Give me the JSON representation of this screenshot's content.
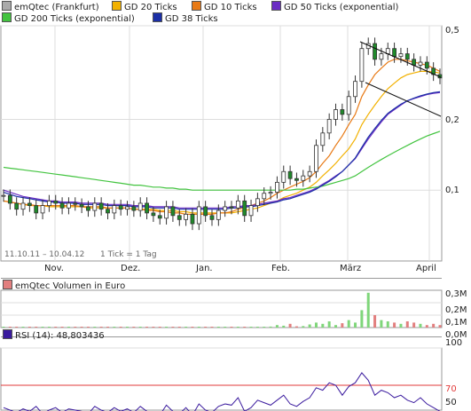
{
  "legend": [
    {
      "label": "emQtec (Frankfurt)",
      "color": "#aaaaaa"
    },
    {
      "label": "GD 20 Ticks",
      "color": "#f2b100"
    },
    {
      "label": "GD 10 Ticks",
      "color": "#e87a16"
    },
    {
      "label": "GD 50 Ticks (exponential)",
      "color": "#6a2cc4"
    },
    {
      "label": "GD 200 Ticks (exponential)",
      "color": "#43c440"
    },
    {
      "label": "GD 38 Ticks",
      "color": "#1b2fa6"
    }
  ],
  "price_panel": {
    "date_range": "11.10.11 – 10.04.12",
    "tick_info": "1 Tick = 1 Tag",
    "y_ticks": [
      "0,5",
      "0,2",
      "0,1"
    ],
    "x_ticks": [
      "Nov.",
      "Dez.",
      "Jan.",
      "Feb.",
      "März",
      "April"
    ]
  },
  "volume_panel": {
    "title": "emQtec Volumen in Euro",
    "y_ticks": [
      "0,3M",
      "0,2M",
      "0,1M",
      "0,0M"
    ],
    "color_up": "#7fd67a",
    "color_down": "#e27f7f"
  },
  "rsi_panel": {
    "title": "RSI (14): 48,803436",
    "y_ticks": [
      "100",
      "70",
      "50"
    ],
    "line_color": "#3a1a9e",
    "ref_color": "#e23a3a"
  },
  "chart_data": {
    "type": "line",
    "price": {
      "scale": "log",
      "ylim": [
        0.05,
        0.5
      ],
      "months": [
        "Nov.",
        "Dez.",
        "Jan.",
        "Feb.",
        "März",
        "April"
      ],
      "series": [
        {
          "name": "emQtec (Frankfurt)",
          "values": [
            0.095,
            0.088,
            0.083,
            0.088,
            0.086,
            0.08,
            0.086,
            0.09,
            0.088,
            0.084,
            0.088,
            0.087,
            0.085,
            0.082,
            0.088,
            0.083,
            0.08,
            0.086,
            0.083,
            0.085,
            0.082,
            0.088,
            0.08,
            0.078,
            0.076,
            0.085,
            0.078,
            0.075,
            0.079,
            0.072,
            0.085,
            0.078,
            0.075,
            0.082,
            0.085,
            0.084,
            0.09,
            0.078,
            0.086,
            0.092,
            0.097,
            0.098,
            0.108,
            0.12,
            0.112,
            0.11,
            0.115,
            0.12,
            0.155,
            0.175,
            0.2,
            0.22,
            0.21,
            0.25,
            0.29,
            0.4,
            0.42,
            0.36,
            0.38,
            0.4,
            0.37,
            0.38,
            0.36,
            0.34,
            0.35,
            0.33,
            0.31,
            0.3
          ]
        },
        {
          "name": "GD 20 Ticks",
          "values": [
            0.09,
            0.089,
            0.088,
            0.087,
            0.086,
            0.086,
            0.086,
            0.085,
            0.085,
            0.085,
            0.085,
            0.085,
            0.085,
            0.084,
            0.084,
            0.084,
            0.084,
            0.084,
            0.084,
            0.084,
            0.083,
            0.083,
            0.083,
            0.083,
            0.082,
            0.082,
            0.082,
            0.081,
            0.081,
            0.08,
            0.08,
            0.08,
            0.08,
            0.08,
            0.08,
            0.08,
            0.081,
            0.082,
            0.083,
            0.084,
            0.086,
            0.088,
            0.09,
            0.093,
            0.095,
            0.097,
            0.1,
            0.103,
            0.108,
            0.115,
            0.122,
            0.13,
            0.14,
            0.15,
            0.165,
            0.19,
            0.21,
            0.23,
            0.25,
            0.27,
            0.285,
            0.3,
            0.31,
            0.315,
            0.32,
            0.32,
            0.318,
            0.315
          ]
        },
        {
          "name": "GD 10 Ticks",
          "values": [
            0.09,
            0.089,
            0.088,
            0.087,
            0.087,
            0.086,
            0.086,
            0.086,
            0.086,
            0.086,
            0.086,
            0.086,
            0.085,
            0.085,
            0.085,
            0.085,
            0.084,
            0.084,
            0.084,
            0.084,
            0.083,
            0.083,
            0.082,
            0.082,
            0.081,
            0.081,
            0.08,
            0.08,
            0.079,
            0.079,
            0.079,
            0.079,
            0.079,
            0.08,
            0.08,
            0.081,
            0.083,
            0.084,
            0.086,
            0.088,
            0.09,
            0.093,
            0.097,
            0.1,
            0.103,
            0.106,
            0.109,
            0.113,
            0.12,
            0.13,
            0.14,
            0.155,
            0.17,
            0.19,
            0.21,
            0.25,
            0.28,
            0.31,
            0.33,
            0.35,
            0.36,
            0.36,
            0.355,
            0.35,
            0.345,
            0.34,
            0.33,
            0.32
          ]
        },
        {
          "name": "GD 50 Ticks (exponential)",
          "values": [
            0.1,
            0.098,
            0.096,
            0.094,
            0.093,
            0.092,
            0.091,
            0.09,
            0.09,
            0.089,
            0.089,
            0.089,
            0.088,
            0.088,
            0.088,
            0.088,
            0.087,
            0.087,
            0.087,
            0.087,
            0.086,
            0.086,
            0.086,
            0.085,
            0.085,
            0.085,
            0.085,
            0.084,
            0.084,
            0.084,
            0.084,
            0.084,
            0.084,
            0.084,
            0.084,
            0.085,
            0.085,
            0.086,
            0.086,
            0.087,
            0.088,
            0.089,
            0.09,
            0.092,
            0.093,
            0.095,
            0.097,
            0.099,
            0.102,
            0.106,
            0.11,
            0.115,
            0.12,
            0.128,
            0.136,
            0.15,
            0.165,
            0.18,
            0.195,
            0.21,
            0.22,
            0.23,
            0.24,
            0.245,
            0.25,
            0.255,
            0.258,
            0.26
          ]
        },
        {
          "name": "GD 200 Ticks (exponential)",
          "values": [
            0.125,
            0.124,
            0.123,
            0.122,
            0.121,
            0.12,
            0.119,
            0.118,
            0.117,
            0.116,
            0.115,
            0.114,
            0.113,
            0.112,
            0.111,
            0.11,
            0.109,
            0.108,
            0.107,
            0.106,
            0.105,
            0.105,
            0.104,
            0.103,
            0.103,
            0.102,
            0.102,
            0.101,
            0.101,
            0.1,
            0.1,
            0.1,
            0.1,
            0.1,
            0.1,
            0.1,
            0.1,
            0.1,
            0.1,
            0.1,
            0.1,
            0.1,
            0.1,
            0.1,
            0.1,
            0.101,
            0.101,
            0.102,
            0.103,
            0.104,
            0.106,
            0.108,
            0.11,
            0.112,
            0.115,
            0.12,
            0.125,
            0.13,
            0.135,
            0.14,
            0.145,
            0.15,
            0.155,
            0.16,
            0.165,
            0.17,
            0.174,
            0.178
          ]
        },
        {
          "name": "GD 38 Ticks",
          "values": [
            0.098,
            0.096,
            0.094,
            0.093,
            0.092,
            0.091,
            0.09,
            0.089,
            0.089,
            0.088,
            0.088,
            0.088,
            0.087,
            0.087,
            0.087,
            0.087,
            0.086,
            0.086,
            0.086,
            0.086,
            0.085,
            0.085,
            0.085,
            0.084,
            0.084,
            0.084,
            0.084,
            0.083,
            0.083,
            0.083,
            0.083,
            0.083,
            0.083,
            0.083,
            0.083,
            0.084,
            0.084,
            0.085,
            0.085,
            0.086,
            0.087,
            0.088,
            0.089,
            0.091,
            0.092,
            0.094,
            0.096,
            0.098,
            0.101,
            0.105,
            0.109,
            0.114,
            0.12,
            0.128,
            0.137,
            0.152,
            0.168,
            0.183,
            0.198,
            0.212,
            0.222,
            0.232,
            0.24,
            0.246,
            0.252,
            0.256,
            0.26,
            0.262
          ]
        }
      ]
    },
    "volume": {
      "unit": "M Euro",
      "ylim": [
        0,
        0.3
      ],
      "values": [
        0.003,
        0.002,
        0.004,
        0.002,
        0.003,
        0.002,
        0.005,
        0.003,
        0.002,
        0.002,
        0.003,
        0.002,
        0.004,
        0.002,
        0.003,
        0.002,
        0.002,
        0.003,
        0.002,
        0.004,
        0.002,
        0.003,
        0.002,
        0.002,
        0.003,
        0.002,
        0.004,
        0.002,
        0.003,
        0.002,
        0.002,
        0.003,
        0.002,
        0.004,
        0.002,
        0.003,
        0.002,
        0.002,
        0.003,
        0.002,
        0.004,
        0.008,
        0.02,
        0.015,
        0.03,
        0.01,
        0.012,
        0.025,
        0.04,
        0.03,
        0.05,
        0.02,
        0.035,
        0.06,
        0.04,
        0.14,
        0.28,
        0.1,
        0.06,
        0.05,
        0.04,
        0.03,
        0.05,
        0.04,
        0.03,
        0.02,
        0.03,
        0.02
      ]
    },
    "rsi": {
      "ylim": [
        50,
        100
      ],
      "reference": 70,
      "values": [
        52,
        50,
        48,
        51,
        49,
        53,
        47,
        50,
        52,
        48,
        51,
        50,
        49,
        47,
        53,
        50,
        48,
        52,
        49,
        51,
        48,
        53,
        49,
        47,
        46,
        54,
        49,
        47,
        52,
        46,
        55,
        50,
        48,
        53,
        55,
        54,
        60,
        49,
        52,
        58,
        56,
        54,
        58,
        62,
        55,
        53,
        57,
        60,
        68,
        66,
        72,
        70,
        62,
        69,
        72,
        80,
        74,
        62,
        66,
        64,
        60,
        62,
        58,
        56,
        60,
        55,
        52,
        49
      ]
    }
  }
}
